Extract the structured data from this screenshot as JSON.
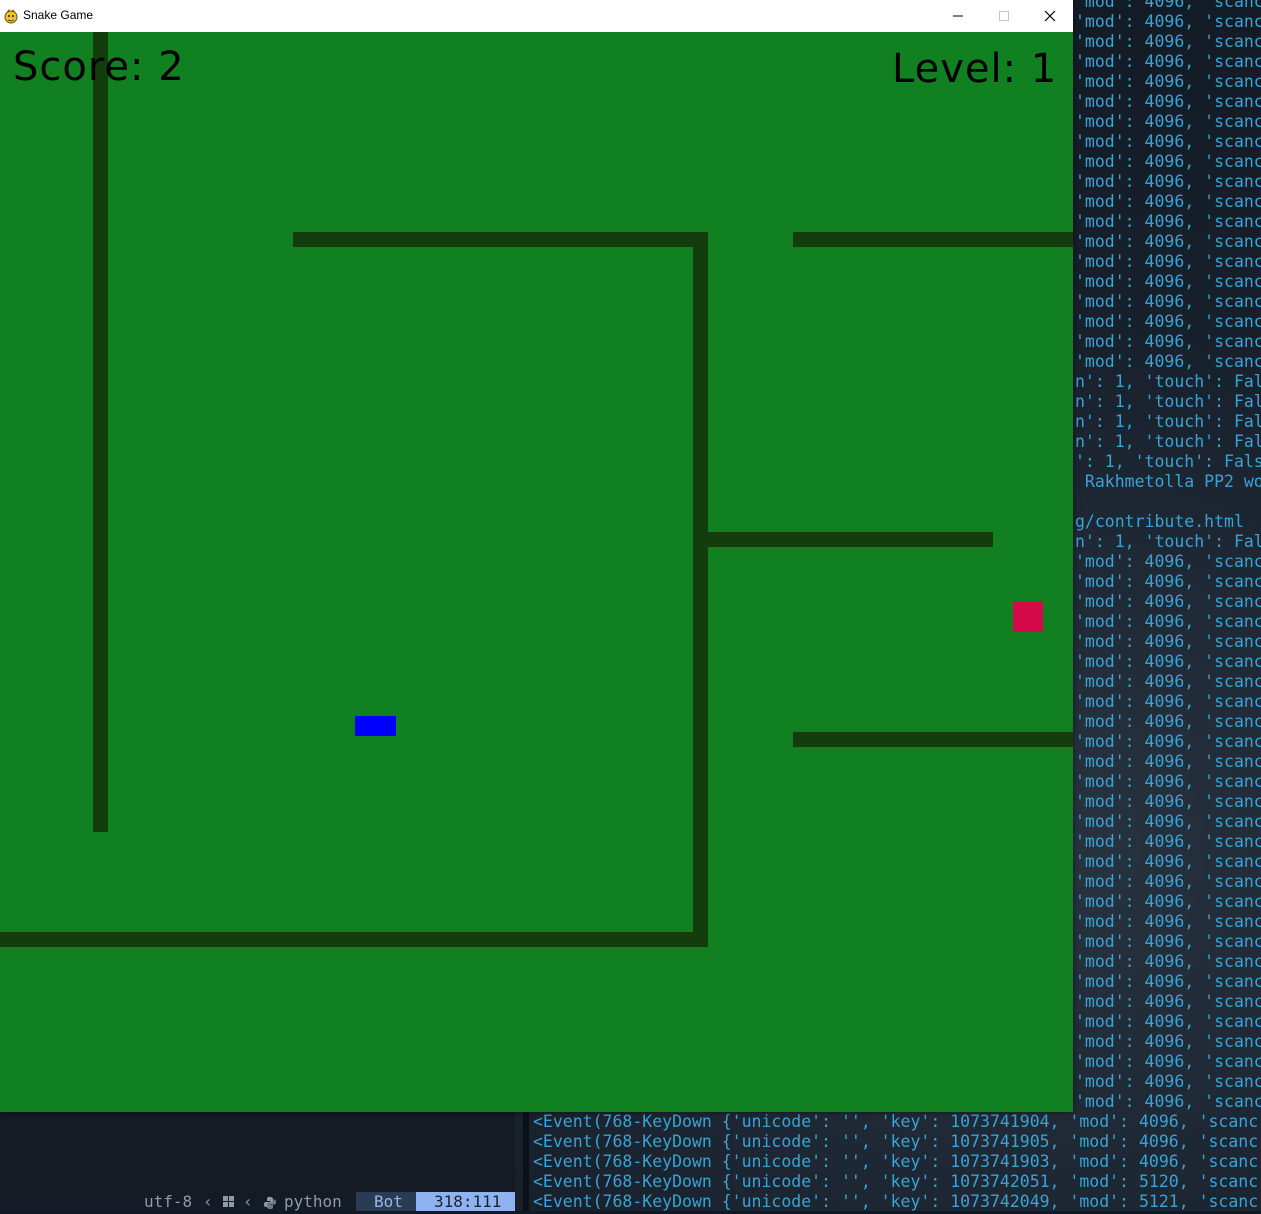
{
  "window": {
    "title": "Snake Game",
    "controls": [
      "minimize",
      "maximize",
      "close"
    ]
  },
  "game": {
    "score_label": "Score: 2",
    "level_label": "Level: 1",
    "score": 2,
    "level": 1,
    "colors": {
      "background": "#118020",
      "walls": "#133d0c",
      "snake": "#0000ff",
      "food": "#d40a4a",
      "text": "#000000"
    }
  },
  "terminal": {
    "right_lines": [
      "'mod': 4096, 'scanc",
      "'mod': 4096, 'scanc",
      "'mod': 4096, 'scanc",
      "'mod': 4096, 'scanc",
      "'mod': 4096, 'scanc",
      "'mod': 4096, 'scanc",
      "'mod': 4096, 'scanc",
      "'mod': 4096, 'scanc",
      "'mod': 4096, 'scanc",
      "'mod': 4096, 'scanc",
      "'mod': 4096, 'scanc",
      "'mod': 4096, 'scanc",
      "'mod': 4096, 'scanc",
      "'mod': 4096, 'scanc",
      "'mod': 4096, 'scanc",
      "'mod': 4096, 'scanc",
      "'mod': 4096, 'scanc",
      "'mod': 4096, 'scanc",
      "'mod': 4096, 'scanc",
      "n': 1, 'touch': Fal",
      "n': 1, 'touch': Fal",
      "n': 1, 'touch': Fal",
      "n': 1, 'touch': Fal",
      "': 1, 'touch': Fals",
      " Rakhmetolla PP2 wo",
      "",
      "g/contribute.html",
      "n': 1, 'touch': Fal",
      "'mod': 4096, 'scanc",
      "'mod': 4096, 'scanc",
      "'mod': 4096, 'scanc",
      "'mod': 4096, 'scanc",
      "'mod': 4096, 'scanc",
      "'mod': 4096, 'scanc",
      "'mod': 4096, 'scanc",
      "'mod': 4096, 'scanc",
      "'mod': 4096, 'scanc",
      "'mod': 4096, 'scanc",
      "'mod': 4096, 'scanc",
      "'mod': 4096, 'scanc",
      "'mod': 4096, 'scanc",
      "'mod': 4096, 'scanc",
      "'mod': 4096, 'scanc",
      "'mod': 4096, 'scanc",
      "'mod': 4096, 'scanc",
      "'mod': 4096, 'scanc",
      "'mod': 4096, 'scanc",
      "'mod': 4096, 'scanc",
      "'mod': 4096, 'scanc",
      "'mod': 4096, 'scanc",
      "'mod': 4096, 'scanc",
      "'mod': 4096, 'scanc",
      "'mod': 4096, 'scanc",
      "'mod': 4096, 'scanc",
      "'mod': 4096, 'scanc",
      "'mod': 4096, 'scanc"
    ],
    "bottom_lines": [
      "<Event(768-KeyDown {'unicode': '', 'key': 1073741904, 'mod': 4096, 'scanc",
      "<Event(768-KeyDown {'unicode': '', 'key': 1073741905, 'mod': 4096, 'scanc",
      "<Event(768-KeyDown {'unicode': '', 'key': 1073741903, 'mod': 4096, 'scanc",
      "<Event(768-KeyDown {'unicode': '', 'key': 1073742051, 'mod': 5120, 'scanc",
      "<Event(768-KeyDown {'unicode': '', 'key': 1073742049, 'mod': 5121, 'scanc"
    ],
    "statusbar": {
      "encoding": "utf-8",
      "language": "python",
      "mode": "Bot",
      "position": "318:111"
    }
  }
}
